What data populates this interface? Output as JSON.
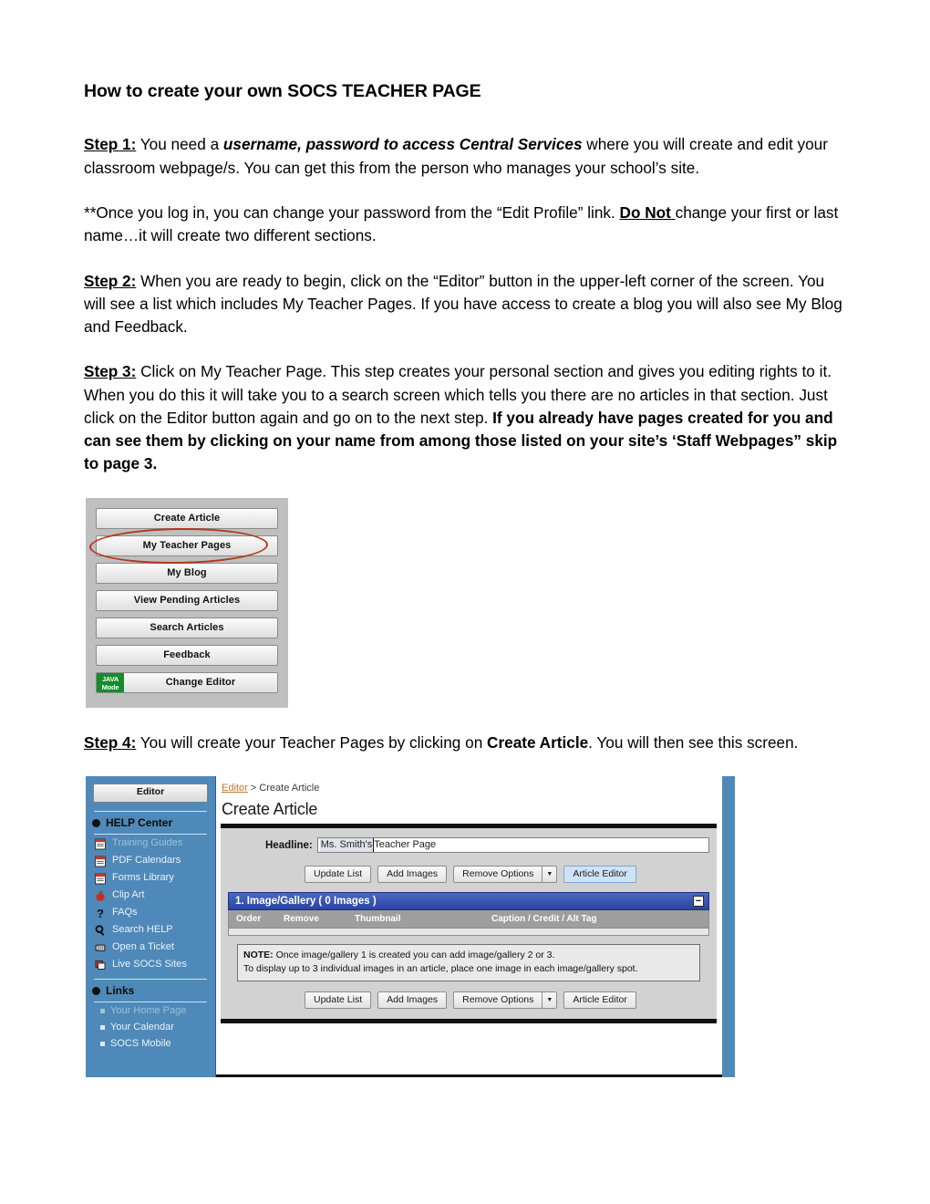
{
  "document": {
    "title": "How to create your own SOCS TEACHER PAGE",
    "step1": {
      "label": "Step 1:",
      "text_a": " You need a ",
      "emphasis": "username, password to access Central Services",
      "text_b": " where you will create and edit your classroom webpage/s. You can get this from the person who manages your school’s site."
    },
    "note_paragraph": {
      "text_a": "**Once you log in, you can change your password from the “Edit Profile” link. ",
      "emphasis": "Do Not ",
      "text_b": "change your first or last name…it will create two different sections."
    },
    "step2": {
      "label": "Step 2:",
      "text": " When you are ready to begin, click on the “Editor” button in the upper-left corner of the screen. You will see a list which includes My Teacher Pages.  If you have access to create a blog you will also see My Blog and Feedback."
    },
    "step3": {
      "label": "Step 3:",
      "text": "  Click on My Teacher Page.  This step creates your personal section and gives you editing rights to it.  When you do this it will take you to a search screen which tells you there are no articles in that section.  Just click on the Editor button again and go on to the next step. ",
      "bold_text": "If you already have pages created for you and can see them by clicking on your name from among those listed on your site’s ‘Staff Webpages” skip to page 3."
    },
    "step4": {
      "label": "Step 4:",
      "text_a": " You will create your Teacher Pages by clicking on ",
      "emphasis": "Create Article",
      "text_b": ".  You will then see this screen."
    }
  },
  "editor_menu": {
    "buttons": [
      {
        "label": "Create Article"
      },
      {
        "label": "My Teacher Pages",
        "annotated": true
      },
      {
        "label": "My Blog"
      },
      {
        "label": "View Pending Articles"
      },
      {
        "label": "Search Articles"
      },
      {
        "label": "Feedback"
      }
    ],
    "change_editor": {
      "badge_line1": "JAVA",
      "badge_line2": "Mode",
      "label": "Change Editor"
    },
    "annotation_color": "#b4381a"
  },
  "create_article_screen": {
    "sidebar": {
      "editor_button": "Editor",
      "help_center_heading": "HELP Center",
      "help_items": [
        {
          "label": "Training Guides",
          "icon": "document-icon",
          "dim": true
        },
        {
          "label": "PDF Calendars",
          "icon": "document-icon",
          "dim": false
        },
        {
          "label": "Forms Library",
          "icon": "document-icon",
          "dim": false
        },
        {
          "label": "Clip Art",
          "icon": "apple-icon",
          "dim": false
        },
        {
          "label": "FAQs",
          "icon": "question-mark-icon",
          "dim": false
        },
        {
          "label": "Search HELP",
          "icon": "magnifier-icon",
          "dim": false
        },
        {
          "label": "Open a Ticket",
          "icon": "ticket-icon",
          "dim": false
        },
        {
          "label": "Live SOCS Sites",
          "icon": "windows-icon",
          "dim": false
        }
      ],
      "links_heading": "Links",
      "links": [
        {
          "label": "Your Home Page",
          "dim": true
        },
        {
          "label": "Your Calendar",
          "dim": false
        },
        {
          "label": "SOCS Mobile",
          "dim": false
        }
      ],
      "background_color": "#4e89b9"
    },
    "breadcrumb": {
      "link": "Editor",
      "separator": " > ",
      "current": "Create Article"
    },
    "page_title": "Create Article",
    "headline": {
      "label": "Headline:",
      "selected_value": "Ms. Smith's",
      "rest_value": " Teacher Page"
    },
    "toolbar_top": {
      "update_list": "Update List",
      "add_images": "Add Images",
      "remove_options": "Remove Options",
      "dropdown_arrow": "▼",
      "article_editor": "Article Editor"
    },
    "gallery": {
      "title": "1. Image/Gallery ( 0 Images )",
      "collapse_icon": "−",
      "columns": [
        "Order",
        "Remove",
        "Thumbnail",
        "Caption / Credit / Alt Tag"
      ],
      "header_color": "#2b44a2"
    },
    "note": {
      "label": "NOTE:",
      "line1": " Once image/gallery 1 is created you can add image/gallery 2 or 3.",
      "line2": "To display up to 3 individual images in an article, place one image in each image/gallery spot."
    },
    "toolbar_bottom": {
      "update_list": "Update List",
      "add_images": "Add Images",
      "remove_options": "Remove Options",
      "dropdown_arrow": "▼",
      "article_editor": "Article Editor"
    }
  }
}
